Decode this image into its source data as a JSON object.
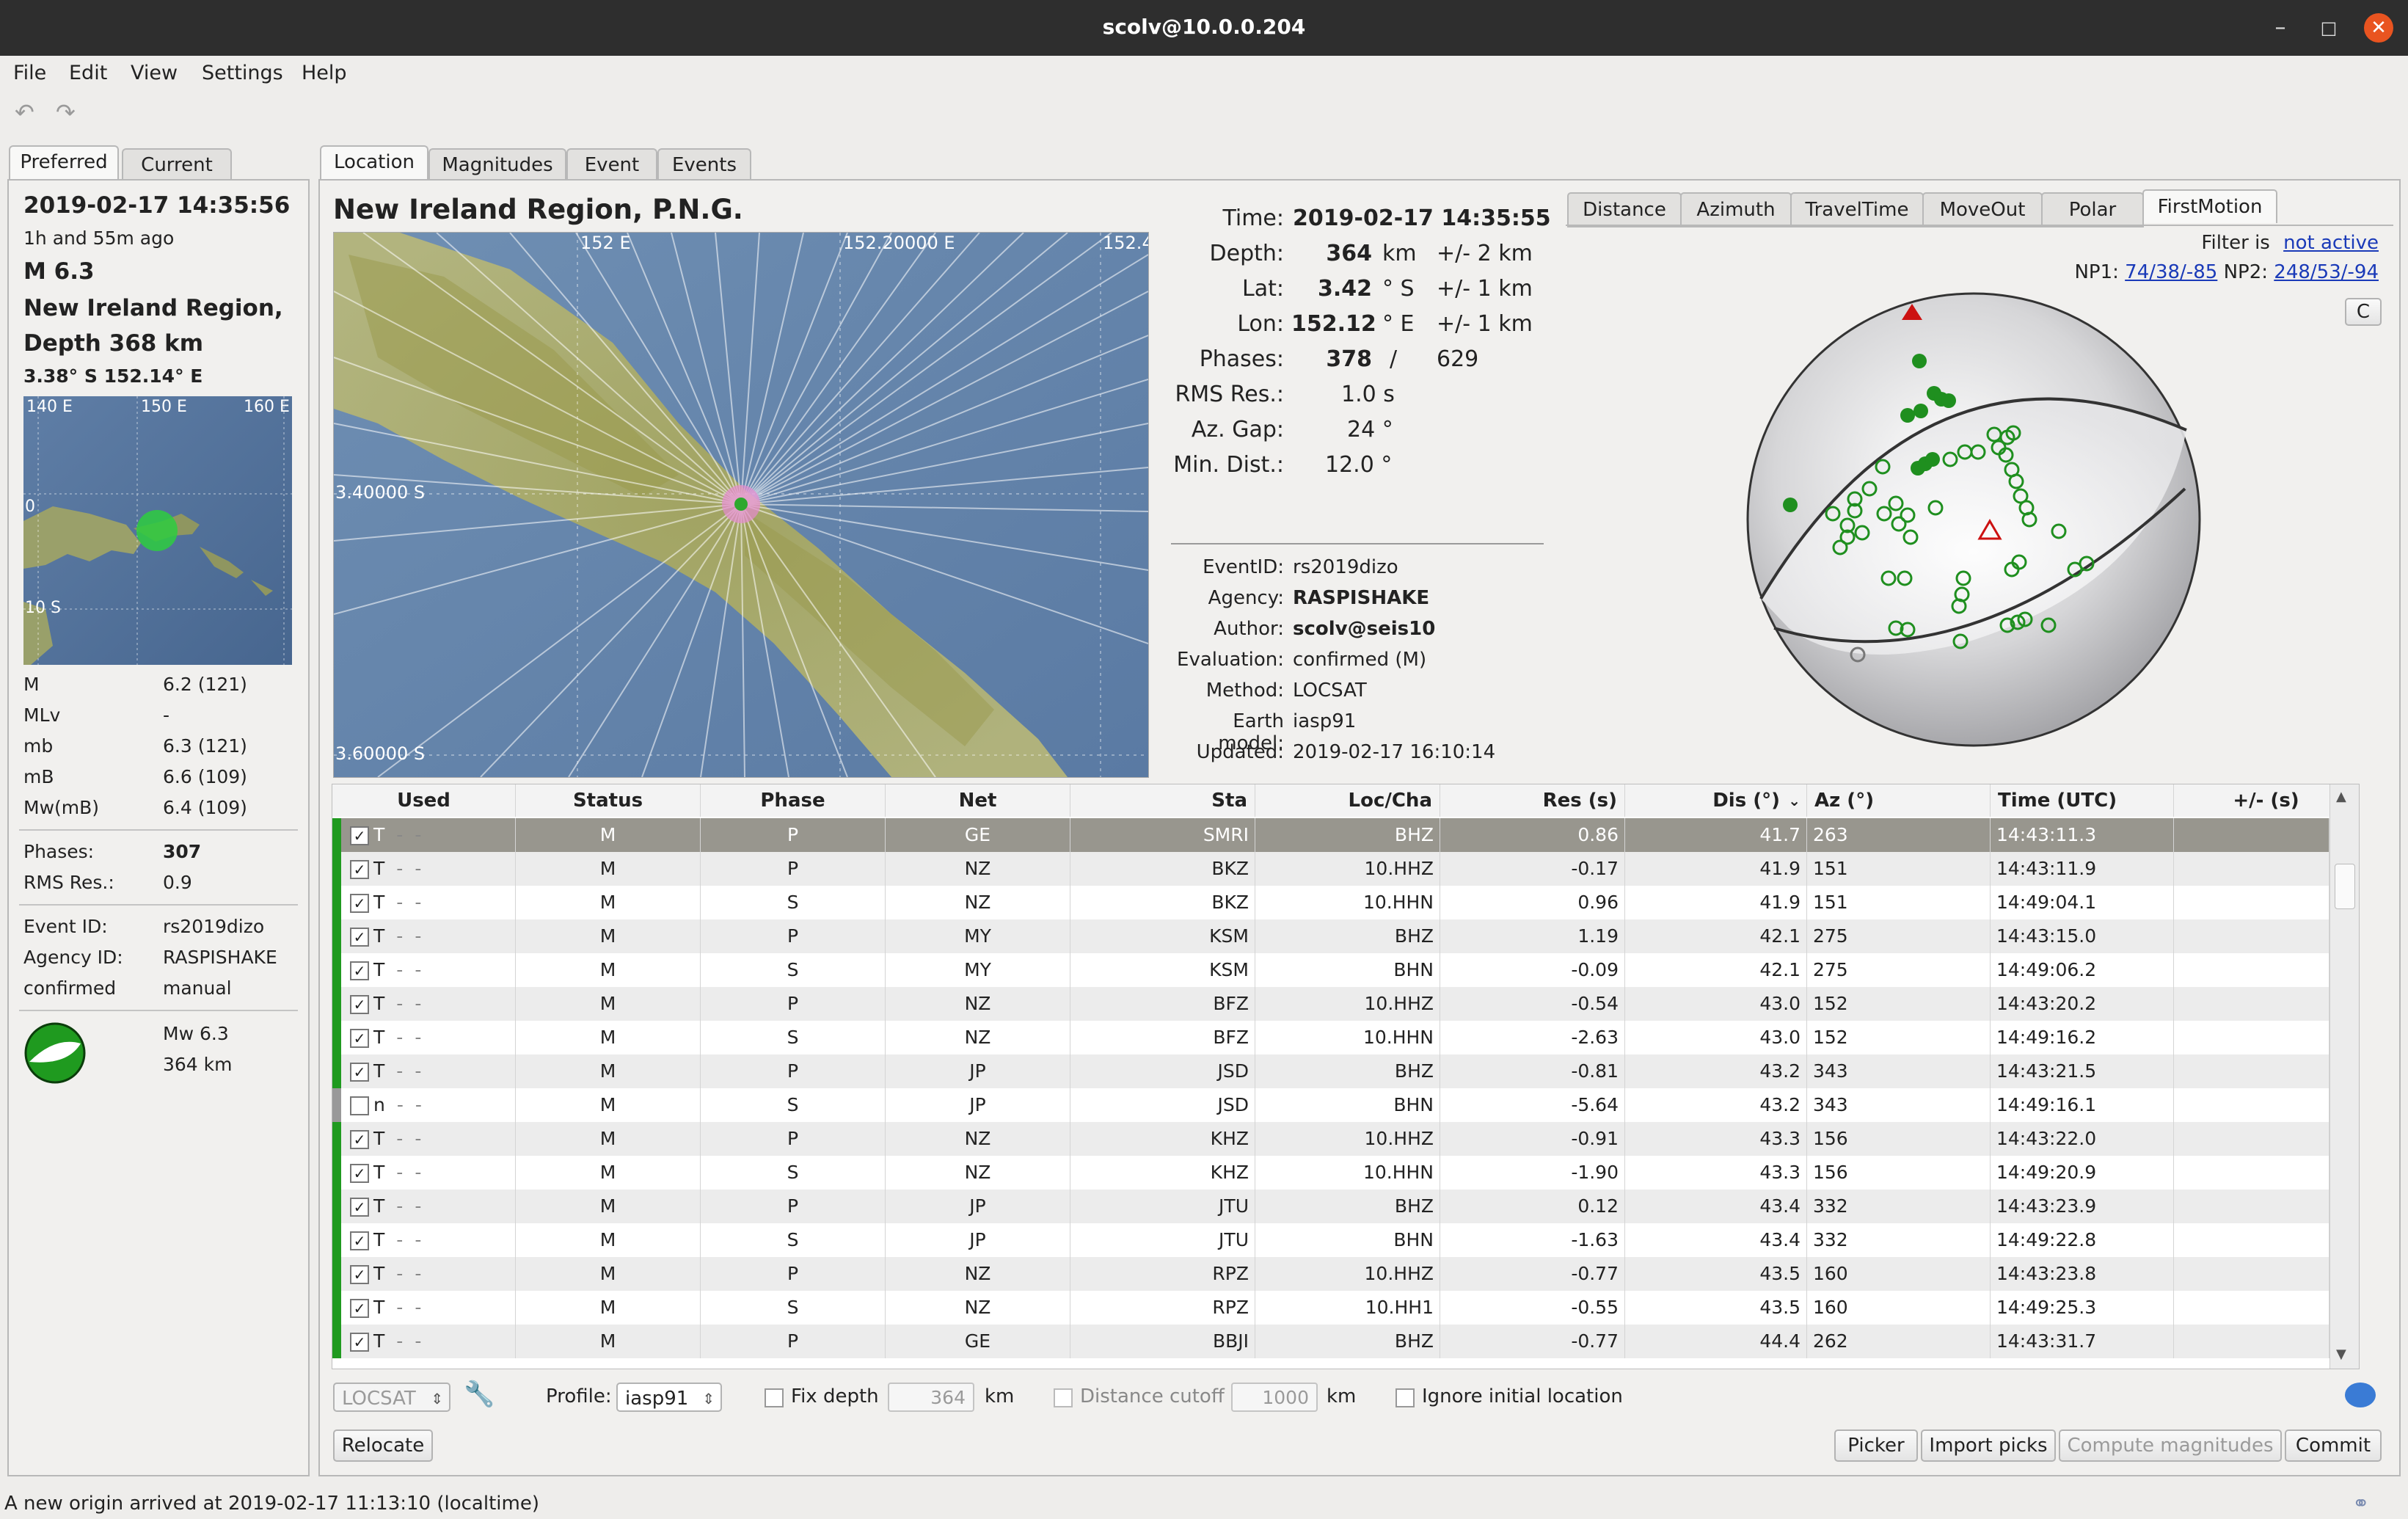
{
  "window": {
    "title": "scolv@10.0.0.204",
    "minimize": "–",
    "maximize": "□",
    "close": "✕"
  },
  "menu": [
    "File",
    "Edit",
    "View",
    "Settings",
    "Help"
  ],
  "toolbar": {
    "undo_icon": "undo-icon",
    "redo_icon": "redo-icon"
  },
  "left_tabs": [
    "Preferred",
    "Current"
  ],
  "left": {
    "time": "2019-02-17 14:35:56",
    "ago": "1h and 55m ago",
    "magnitude": "M 6.3",
    "region": "New Ireland Region, P",
    "depth": "Depth 368 km",
    "coords": "3.38° S  152.14° E",
    "map_labels": {
      "l1": "140 E",
      "l2": "150 E",
      "l3": "160 E",
      "l4": "0",
      "l5": "10 S"
    },
    "mags": [
      {
        "type": "M",
        "value": "6.2 (121)"
      },
      {
        "type": "MLv",
        "value": "-"
      },
      {
        "type": "mb",
        "value": "6.3 (121)"
      },
      {
        "type": "mB",
        "value": "6.6 (109)"
      },
      {
        "type": "Mw(mB)",
        "value": "6.4 (109)"
      }
    ],
    "phases_label": "Phases:",
    "phases_value": "307",
    "rms_label": "RMS Res.:",
    "rms_value": "0.9",
    "event_id_label": "Event ID:",
    "event_id": "rs2019dizo",
    "agency_label": "Agency ID:",
    "agency": "RASPISHAKE",
    "status_label": "confirmed",
    "status_value": "manual",
    "fm_mag": "Mw 6.3",
    "fm_depth": "364 km"
  },
  "main_tabs": [
    "Location",
    "Magnitudes",
    "Event",
    "Events"
  ],
  "location": {
    "region_title": "New Ireland Region, P.N.G.",
    "map_labels": {
      "x1": "152 E",
      "x2": "152.20000 E",
      "x3": "152.4",
      "y1": "3.40000 S",
      "y2": "3.60000 S"
    },
    "time_label": "Time:",
    "time": "2019-02-17 14:35:55",
    "depth_label": "Depth:",
    "depth": "364",
    "depth_unit": "km",
    "depth_err": "+/- 2  km",
    "lat_label": "Lat:",
    "lat": "3.42",
    "lat_unit": "° S",
    "lat_err": "+/- 1  km",
    "lon_label": "Lon:",
    "lon": "152.12",
    "lon_unit": "° E",
    "lon_err": "+/- 1  km",
    "phases_label": "Phases:",
    "phases": "378",
    "phases_sep": "/",
    "phases_total": "629",
    "rms_label": "RMS Res.:",
    "rms": "1.0  s",
    "azgap_label": "Az. Gap:",
    "azgap": "24  °",
    "mindist_label": "Min. Dist.:",
    "mindist": "12.0  °",
    "meta": [
      {
        "label": "EventID:",
        "value": "rs2019dizo",
        "bold": false
      },
      {
        "label": "Agency:",
        "value": "RASPISHAKE",
        "bold": true
      },
      {
        "label": "Author:",
        "value": "scolv@seis10",
        "bold": true
      },
      {
        "label": "Evaluation:",
        "value": "confirmed (M)",
        "bold": false
      },
      {
        "label": "Method:",
        "value": "LOCSAT",
        "bold": false
      },
      {
        "label": "Earth model:",
        "value": "iasp91",
        "bold": false
      },
      {
        "label": "Updated:",
        "value": "2019-02-17 16:10:14",
        "bold": false
      }
    ]
  },
  "fm_tabs": [
    "Distance",
    "Azimuth",
    "TravelTime",
    "MoveOut",
    "Polar",
    "FirstMotion"
  ],
  "fm": {
    "filter_label": "Filter is",
    "filter_state": "not active",
    "np1_label": "NP1:",
    "np1": "74/38/-85",
    "np2_label": "NP2:",
    "np2": "248/53/-94",
    "corner_btn": "C"
  },
  "table": {
    "headers": [
      "Used",
      "Status",
      "Phase",
      "Net",
      "Sta",
      "Loc/Cha",
      "Res (s)",
      "Dis (°)",
      "Az (°)",
      "Time (UTC)",
      "+/- (s)"
    ],
    "rows": [
      {
        "used": "T",
        "checked": true,
        "status": "M",
        "phase": "P",
        "net": "GE",
        "sta": "SMRI",
        "loccha": "BHZ",
        "res": "0.86",
        "dis": "41.7",
        "az": "263",
        "time": "14:43:11.3"
      },
      {
        "used": "T",
        "checked": true,
        "status": "M",
        "phase": "P",
        "net": "NZ",
        "sta": "BKZ",
        "loccha": "10.HHZ",
        "res": "-0.17",
        "dis": "41.9",
        "az": "151",
        "time": "14:43:11.9"
      },
      {
        "used": "T",
        "checked": true,
        "status": "M",
        "phase": "S",
        "net": "NZ",
        "sta": "BKZ",
        "loccha": "10.HHN",
        "res": "0.96",
        "dis": "41.9",
        "az": "151",
        "time": "14:49:04.1"
      },
      {
        "used": "T",
        "checked": true,
        "status": "M",
        "phase": "P",
        "net": "MY",
        "sta": "KSM",
        "loccha": "BHZ",
        "res": "1.19",
        "dis": "42.1",
        "az": "275",
        "time": "14:43:15.0"
      },
      {
        "used": "T",
        "checked": true,
        "status": "M",
        "phase": "S",
        "net": "MY",
        "sta": "KSM",
        "loccha": "BHN",
        "res": "-0.09",
        "dis": "42.1",
        "az": "275",
        "time": "14:49:06.2"
      },
      {
        "used": "T",
        "checked": true,
        "status": "M",
        "phase": "P",
        "net": "NZ",
        "sta": "BFZ",
        "loccha": "10.HHZ",
        "res": "-0.54",
        "dis": "43.0",
        "az": "152",
        "time": "14:43:20.2"
      },
      {
        "used": "T",
        "checked": true,
        "status": "M",
        "phase": "S",
        "net": "NZ",
        "sta": "BFZ",
        "loccha": "10.HHN",
        "res": "-2.63",
        "dis": "43.0",
        "az": "152",
        "time": "14:49:16.2"
      },
      {
        "used": "T",
        "checked": true,
        "status": "M",
        "phase": "P",
        "net": "JP",
        "sta": "JSD",
        "loccha": "BHZ",
        "res": "-0.81",
        "dis": "43.2",
        "az": "343",
        "time": "14:43:21.5"
      },
      {
        "used": "n",
        "checked": false,
        "status": "M",
        "phase": "S",
        "net": "JP",
        "sta": "JSD",
        "loccha": "BHN",
        "res": "-5.64",
        "dis": "43.2",
        "az": "343",
        "time": "14:49:16.1"
      },
      {
        "used": "T",
        "checked": true,
        "status": "M",
        "phase": "P",
        "net": "NZ",
        "sta": "KHZ",
        "loccha": "10.HHZ",
        "res": "-0.91",
        "dis": "43.3",
        "az": "156",
        "time": "14:43:22.0"
      },
      {
        "used": "T",
        "checked": true,
        "status": "M",
        "phase": "S",
        "net": "NZ",
        "sta": "KHZ",
        "loccha": "10.HHN",
        "res": "-1.90",
        "dis": "43.3",
        "az": "156",
        "time": "14:49:20.9"
      },
      {
        "used": "T",
        "checked": true,
        "status": "M",
        "phase": "P",
        "net": "JP",
        "sta": "JTU",
        "loccha": "BHZ",
        "res": "0.12",
        "dis": "43.4",
        "az": "332",
        "time": "14:43:23.9"
      },
      {
        "used": "T",
        "checked": true,
        "status": "M",
        "phase": "S",
        "net": "JP",
        "sta": "JTU",
        "loccha": "BHN",
        "res": "-1.63",
        "dis": "43.4",
        "az": "332",
        "time": "14:49:22.8"
      },
      {
        "used": "T",
        "checked": true,
        "status": "M",
        "phase": "P",
        "net": "NZ",
        "sta": "RPZ",
        "loccha": "10.HHZ",
        "res": "-0.77",
        "dis": "43.5",
        "az": "160",
        "time": "14:43:23.8"
      },
      {
        "used": "T",
        "checked": true,
        "status": "M",
        "phase": "S",
        "net": "NZ",
        "sta": "RPZ",
        "loccha": "10.HH1",
        "res": "-0.55",
        "dis": "43.5",
        "az": "160",
        "time": "14:49:25.3"
      },
      {
        "used": "T",
        "checked": true,
        "status": "M",
        "phase": "P",
        "net": "GE",
        "sta": "BBJI",
        "loccha": "BHZ",
        "res": "-0.77",
        "dis": "44.4",
        "az": "262",
        "time": "14:43:31.7"
      }
    ],
    "sort_icon": "sort-desc-icon"
  },
  "controls": {
    "locator": "LOCSAT",
    "profile_label": "Profile:",
    "profile": "iasp91",
    "fix_depth_label": "Fix depth",
    "fix_depth_value": "364",
    "km1": "km",
    "dist_cutoff_label": "Distance cutoff",
    "dist_cutoff_value": "1000",
    "km2": "km",
    "ignore_label": "Ignore initial location",
    "relocate": "Relocate",
    "picker": "Picker",
    "import_picks": "Import picks",
    "compute_mags": "Compute magnitudes",
    "commit": "Commit"
  },
  "status": {
    "message": "A new origin arrived at 2019-02-17 11:13:10 (localtime)"
  },
  "colors": {
    "accent_green": "#1f9a1f",
    "selected_row": "#98968e",
    "close_btn": "#e95420",
    "link": "#1a3ab8"
  }
}
